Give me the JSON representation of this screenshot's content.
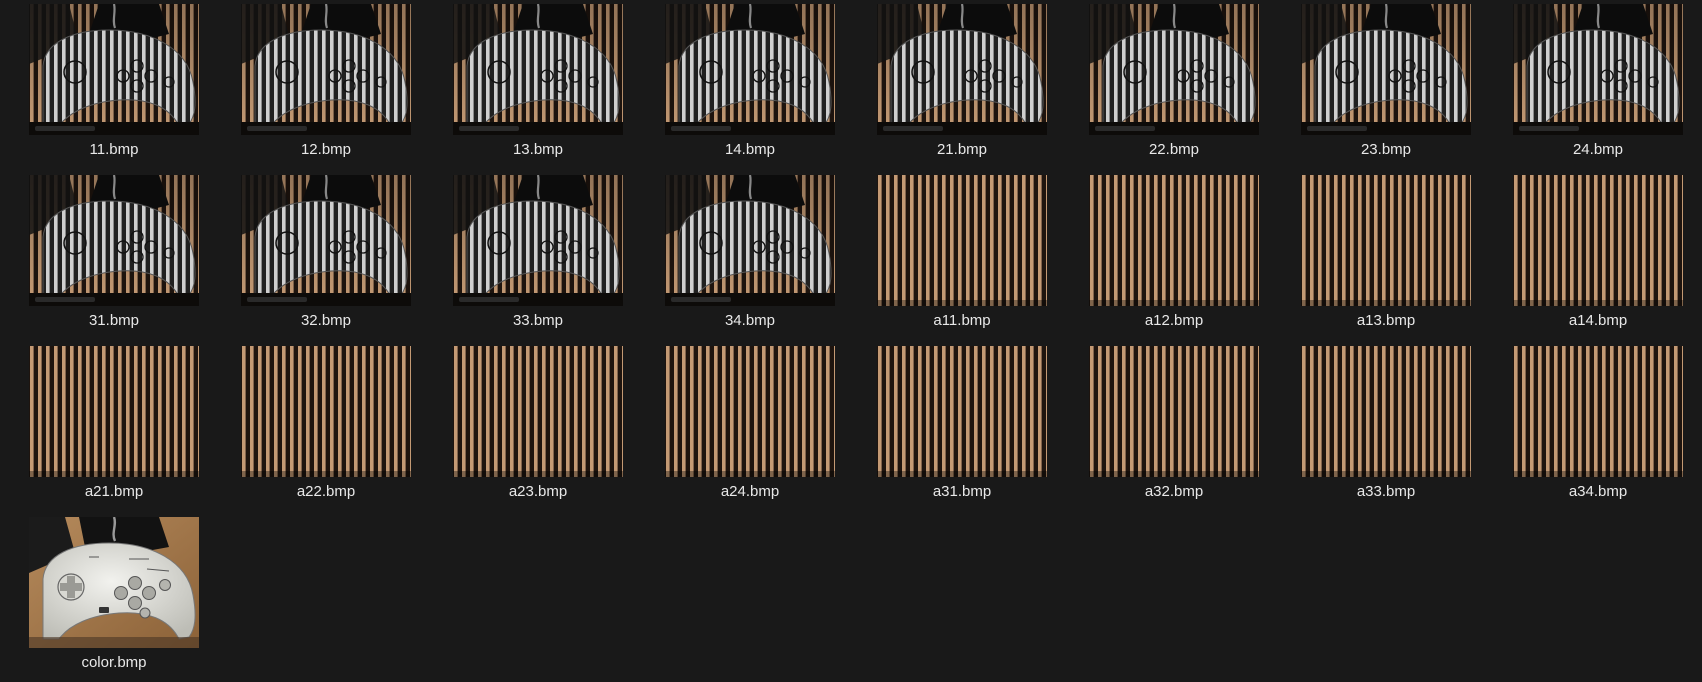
{
  "files": [
    {
      "name": "11.bmp",
      "kind": "gamepad-fringe"
    },
    {
      "name": "12.bmp",
      "kind": "gamepad-fringe"
    },
    {
      "name": "13.bmp",
      "kind": "gamepad-fringe"
    },
    {
      "name": "14.bmp",
      "kind": "gamepad-fringe"
    },
    {
      "name": "21.bmp",
      "kind": "gamepad-fringe"
    },
    {
      "name": "22.bmp",
      "kind": "gamepad-fringe"
    },
    {
      "name": "23.bmp",
      "kind": "gamepad-fringe"
    },
    {
      "name": "24.bmp",
      "kind": "gamepad-fringe"
    },
    {
      "name": "31.bmp",
      "kind": "gamepad-fringe"
    },
    {
      "name": "32.bmp",
      "kind": "gamepad-fringe"
    },
    {
      "name": "33.bmp",
      "kind": "gamepad-fringe"
    },
    {
      "name": "34.bmp",
      "kind": "gamepad-fringe"
    },
    {
      "name": "a11.bmp",
      "kind": "fringe"
    },
    {
      "name": "a12.bmp",
      "kind": "fringe"
    },
    {
      "name": "a13.bmp",
      "kind": "fringe"
    },
    {
      "name": "a14.bmp",
      "kind": "fringe"
    },
    {
      "name": "a21.bmp",
      "kind": "fringe"
    },
    {
      "name": "a22.bmp",
      "kind": "fringe"
    },
    {
      "name": "a23.bmp",
      "kind": "fringe"
    },
    {
      "name": "a24.bmp",
      "kind": "fringe"
    },
    {
      "name": "a31.bmp",
      "kind": "fringe"
    },
    {
      "name": "a32.bmp",
      "kind": "fringe"
    },
    {
      "name": "a33.bmp",
      "kind": "fringe"
    },
    {
      "name": "a34.bmp",
      "kind": "fringe"
    },
    {
      "name": "color.bmp",
      "kind": "gamepad-color"
    }
  ],
  "colors": {
    "background": "#191919",
    "label": "#e8e8e8",
    "fringe_light": "#c49a74",
    "fringe_dark": "#1e140e"
  }
}
